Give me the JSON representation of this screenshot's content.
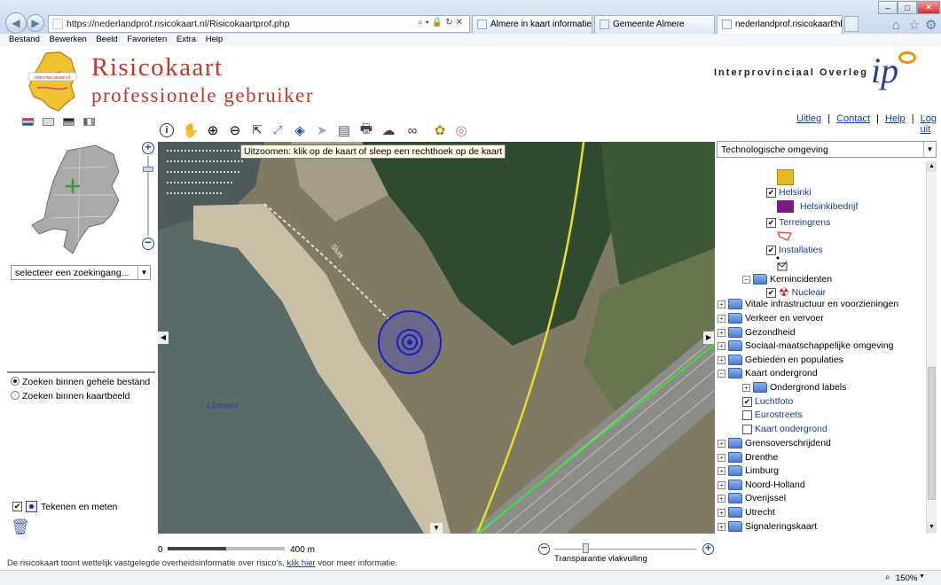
{
  "browser": {
    "url": "https://nederlandprof.risicokaart.nl/Risicokaartprof.php",
    "tabs": [
      {
        "label": "Almere in kaart informatieport..."
      },
      {
        "label": "Gemeente Almere"
      },
      {
        "label": "nederlandprof.risicokaart.nl"
      }
    ],
    "menu": [
      "Bestand",
      "Bewerken",
      "Beeld",
      "Favorieten",
      "Extra",
      "Help"
    ],
    "zoom": "150%"
  },
  "header": {
    "title_line1": "Risicokaart",
    "title_line2": "professionele gebruiker",
    "logo_small_text": "www.risicokaart.nl",
    "org": "Interprovinciaal Overleg",
    "org_logo": "ip"
  },
  "toplinks": {
    "uitleg": "Uitleg",
    "contact": "Contact",
    "help": "Help",
    "logout": "Log uit",
    "sep": "|"
  },
  "tooltip": "Uitzoomen: klik op de kaart of sleep een rechthoek op de kaart",
  "left": {
    "search_select": "selecteer  een zoekingang...",
    "radio1": "Zoeken binnen gehele bestand",
    "radio2": "Zoeken binnen kaartbeeld",
    "draw_label": "Tekenen en meten"
  },
  "map": {
    "water_label": "IJmeer",
    "road_label": "Sluis"
  },
  "right": {
    "theme_select": "Technologische omgeving",
    "tree": [
      {
        "label": "Helsinki"
      },
      {
        "label": "Helsinkibedrijf"
      },
      {
        "label": "Terreingrens"
      },
      {
        "label": "Installaties"
      },
      {
        "label": "Kernincidenten"
      },
      {
        "label": "Nucleair"
      },
      {
        "label": "Vitale infrastructuur en voorzieningen"
      },
      {
        "label": "Verkeer en vervoer"
      },
      {
        "label": "Gezondheid"
      },
      {
        "label": "Sociaal-maatschappelijke omgeving"
      },
      {
        "label": "Gebieden en populaties"
      },
      {
        "label": "Kaart ondergrond"
      },
      {
        "label": "Ondergrond labels"
      },
      {
        "label": "Luchtfoto"
      },
      {
        "label": "Eurostreets"
      },
      {
        "label": "Kaart ondergrond"
      },
      {
        "label": "Grensoverschrijdend"
      },
      {
        "label": "Drenthe"
      },
      {
        "label": "Limburg"
      },
      {
        "label": "Noord-Holland"
      },
      {
        "label": "Overijssel"
      },
      {
        "label": "Utrecht"
      },
      {
        "label": "Signaleringskaart"
      }
    ]
  },
  "bottom": {
    "scale_left": "0",
    "scale_right": "400 m",
    "disclaimer_pre": "De risicokaart toont wettelijk vastgelegde overheidsinformatie over risico's,",
    "disclaimer_link": "klik hier",
    "disclaimer_post": "voor meer informatie.",
    "transparency_label": "Transparantie vlakvulling",
    "transparency_value": 0.22
  },
  "colors": {
    "brand_red": "#c0392b",
    "link_blue": "#1a3c9c",
    "helsinki_yellow": "#e8b923",
    "helsinkibedrijf_purple": "#7a1c7e"
  }
}
